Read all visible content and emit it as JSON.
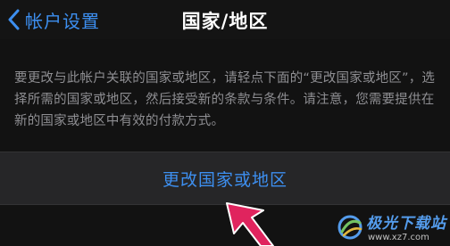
{
  "nav": {
    "back_label": "帐户设置",
    "title": "国家/地区"
  },
  "main": {
    "description": "要更改与此帐户关联的国家或地区，请轻点下面的“更改国家或地区”，选择所需的国家或地区，然后接受新的条款与条件。请注意，您需要提供在新的国家或地区中有效的付款方式。",
    "change_region_label": "更改国家或地区"
  },
  "watermark": {
    "name": "极光下载站",
    "url": "www.xz7.com"
  },
  "colors": {
    "accent": "#3d8ff0",
    "background": "#121212",
    "row_background": "#262628",
    "secondary_text": "#8e8e92",
    "annotation_arrow": "#e0245e"
  },
  "icons": {
    "back": "chevron-left-icon",
    "annotation": "red-arrow-icon",
    "watermark_logo": "aurora-logo-icon"
  }
}
